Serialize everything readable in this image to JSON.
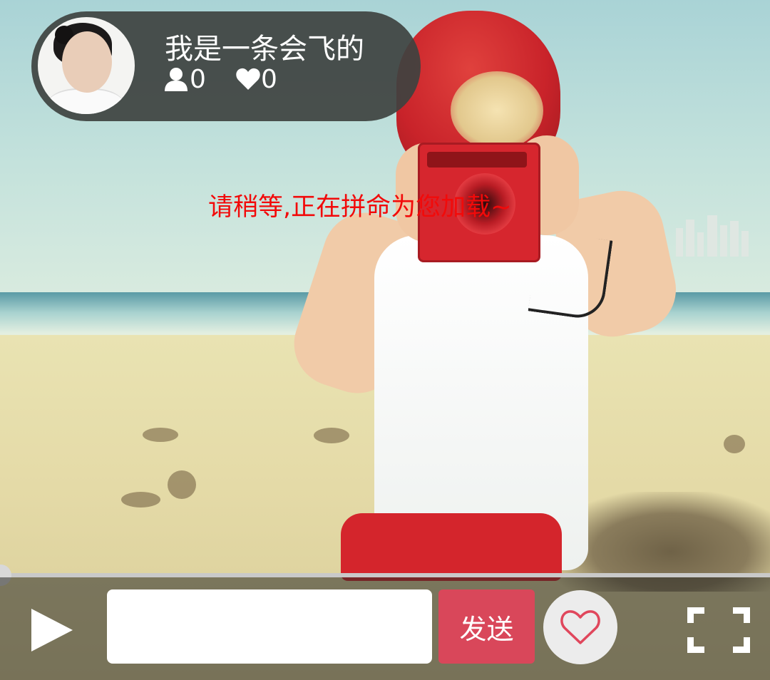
{
  "player": {
    "loading_text": "请稍等,正在拼命为您加载~",
    "progress": 0
  },
  "author": {
    "name": "我是一条会飞的",
    "followers": "0",
    "likes": "0",
    "avatar_icon": "avatar-photo"
  },
  "controls": {
    "play_icon": "play-icon",
    "comment_value": "",
    "send_label": "发送",
    "like_icon": "heart-outline-icon",
    "fullscreen_icon": "fullscreen-icon"
  },
  "colors": {
    "loading_text": "#f20a0a",
    "send_button": "#d9475a",
    "info_pill": "#3e4240",
    "heart_outline": "#e0475c"
  }
}
